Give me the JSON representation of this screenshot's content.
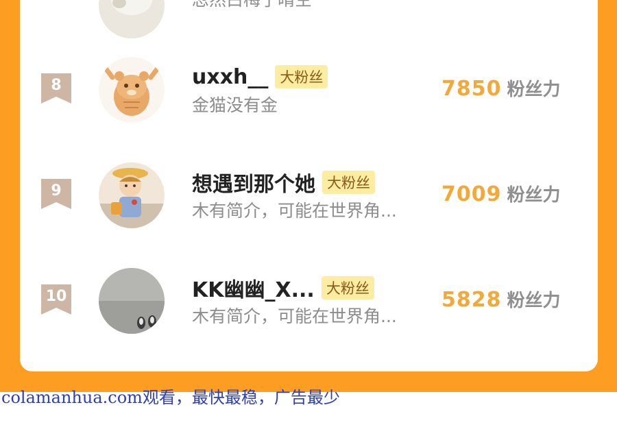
{
  "previous_entry": {
    "bio_fragment": "忽然白梅了晴空"
  },
  "leaderboard": [
    {
      "rank": "8",
      "username": "uxxh__",
      "tag": "大粉丝",
      "bio": "金猫没有金",
      "score": "7850",
      "score_unit": "粉丝力",
      "avatar": "tiger-cartoon-avatar"
    },
    {
      "rank": "9",
      "username": "想遇到那个她",
      "tag": "大粉丝",
      "bio": "木有简介，可能在世界角...",
      "score": "7009",
      "score_unit": "粉丝力",
      "avatar": "anime-character-avatar"
    },
    {
      "rank": "10",
      "username": "KK幽幽_X...",
      "tag": "大粉丝",
      "bio": "木有简介，可能在世界角...",
      "score": "5828",
      "score_unit": "粉丝力",
      "avatar": "gray-photo-avatar"
    }
  ],
  "watermark": "colamanhua.com观看，最快最稳，广告最少",
  "colors": {
    "page_orange": "#fd9d21",
    "score_orange": "#f3a93a",
    "tag_yellow": "#fdeda3",
    "rank_badge": "#cdb6a4"
  }
}
